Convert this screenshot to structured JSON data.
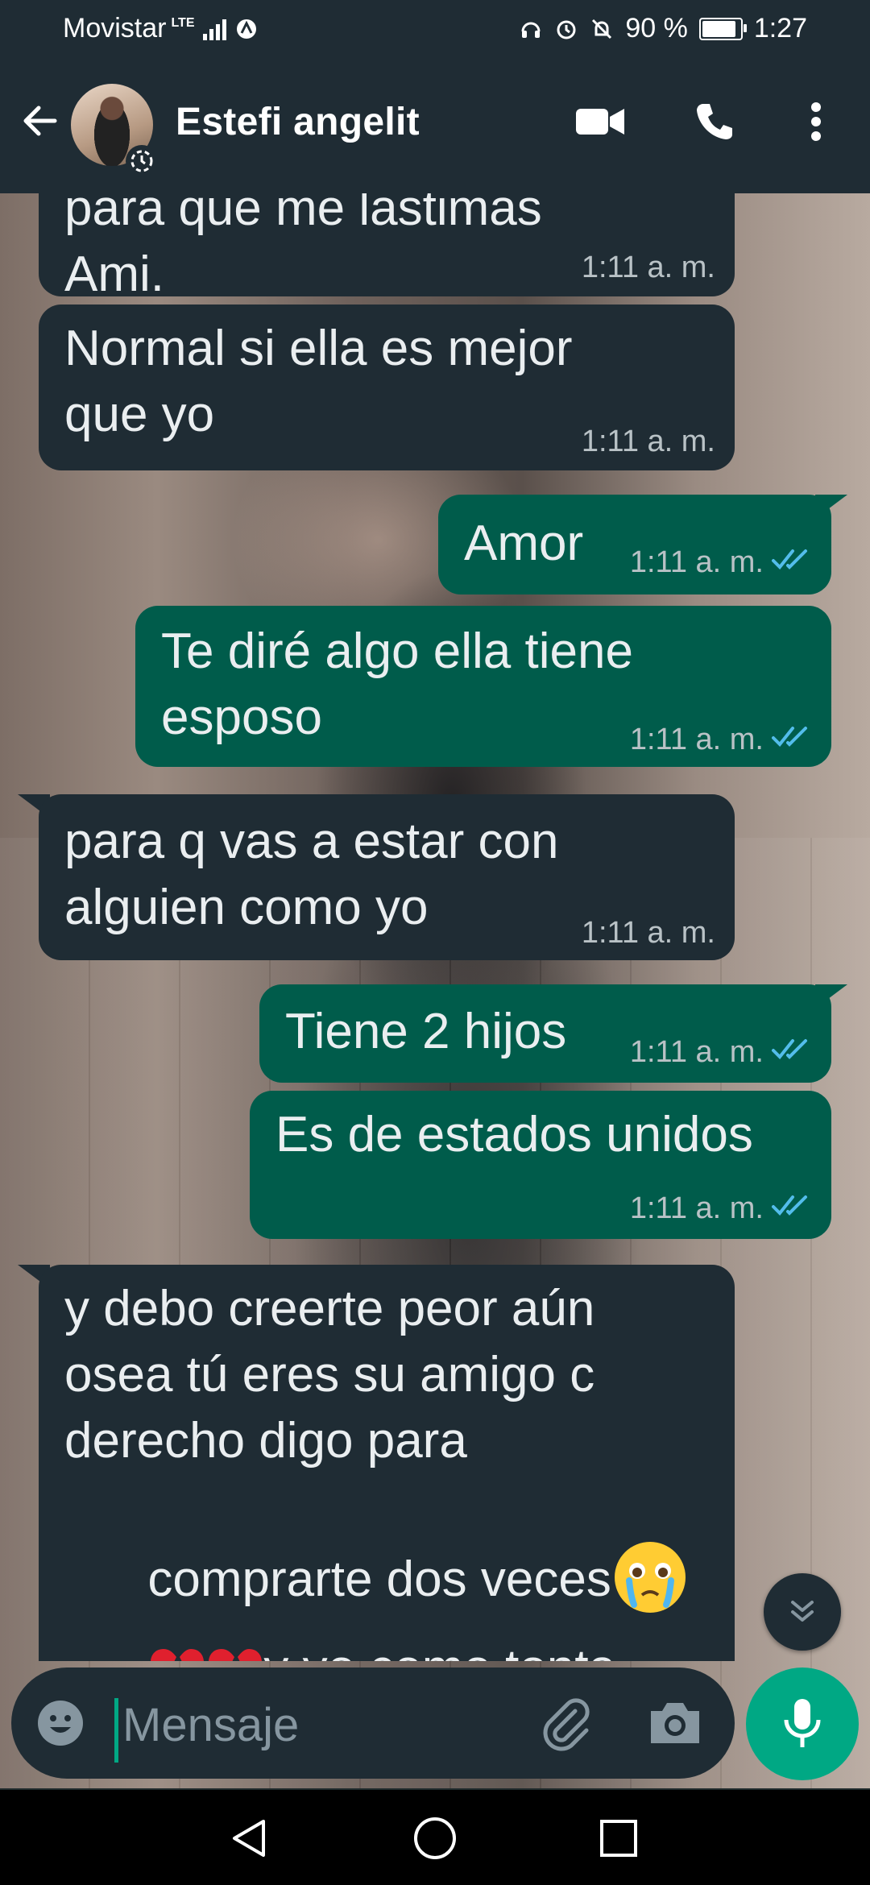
{
  "status_bar": {
    "carrier": "Movistar",
    "network": "LTE",
    "battery": "90 %",
    "battery_level": 0.9,
    "time": "1:27"
  },
  "header": {
    "contact_name": "Estefi angelit",
    "icons": [
      "back-arrow-icon",
      "video-call-icon",
      "voice-call-icon",
      "more-options-icon"
    ]
  },
  "messages": [
    {
      "dir": "in",
      "text": "para que me lastimas\nAmi.",
      "time": "1:11 a. m."
    },
    {
      "dir": "in",
      "text": "Normal si ella es mejor\nque yo",
      "time": "1:11 a. m."
    },
    {
      "dir": "out",
      "text": "Amor",
      "time": "1:11 a. m."
    },
    {
      "dir": "out",
      "text": "Te diré algo ella tiene\nesposo",
      "time": "1:11 a. m."
    },
    {
      "dir": "in",
      "text": "para q vas a estar con\nalguien como yo",
      "time": "1:11 a. m."
    },
    {
      "dir": "out",
      "text": "Tiene 2 hijos",
      "time": "1:11 a. m."
    },
    {
      "dir": "out",
      "text": "Es de estados unidos",
      "time": "1:11 a. m."
    },
    {
      "dir": "in",
      "line1": "y debo creerte peor aún",
      "line2": "osea tú eres su amigo c",
      "line3": "derecho digo para",
      "line4": "comprarte dos veces",
      "line5": "y yo como tonta"
    }
  ],
  "composer": {
    "placeholder": "Mensaje",
    "icons": [
      "emoji-icon",
      "attach-icon",
      "camera-icon",
      "mic-icon"
    ]
  },
  "nav": [
    "back-triangle-icon",
    "home-circle-icon",
    "recents-square-icon"
  ]
}
